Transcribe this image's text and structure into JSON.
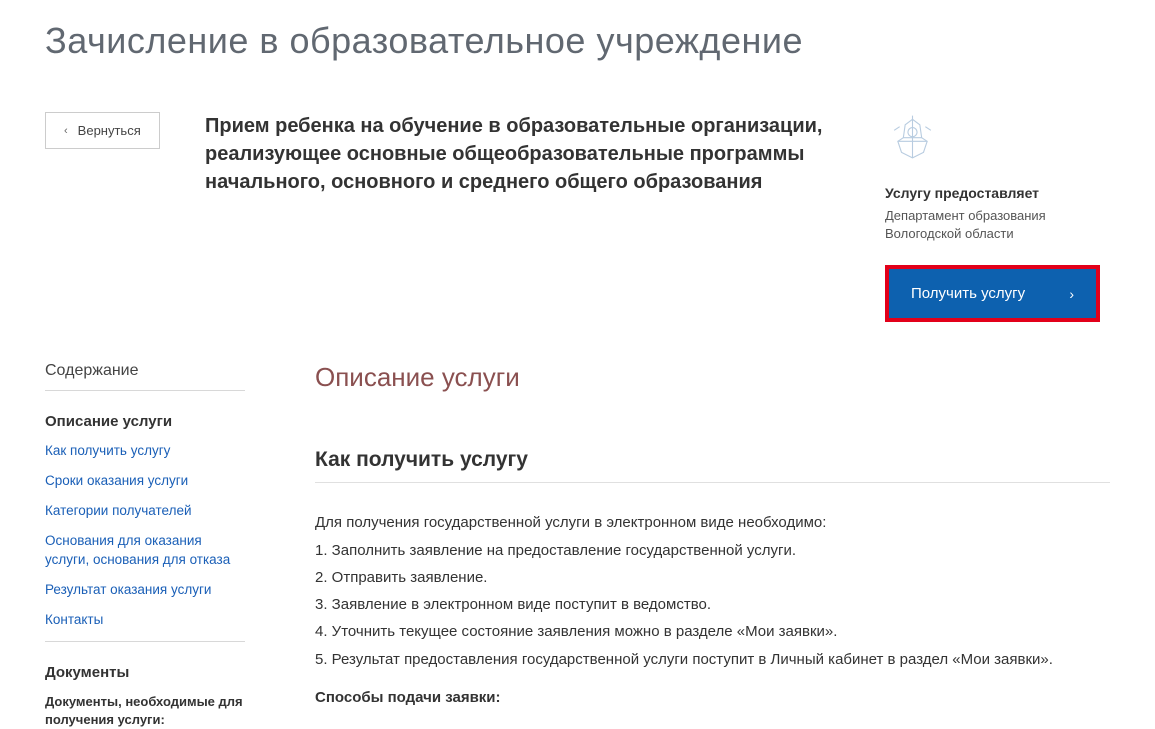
{
  "pageTitle": "Зачисление в образовательное учреждение",
  "backButton": "Вернуться",
  "subtitle": "Прием ребенка на обучение в образовательные организации, реализующее основные общеобразовательные программы начального, основного и среднего общего образования",
  "providerLabel": "Услугу предоставляет",
  "providerName": "Департамент образования Вологодской области",
  "getServiceLabel": "Получить услугу",
  "toc": {
    "title": "Содержание",
    "heading1": "Описание услуги",
    "links": [
      "Как получить услугу",
      "Сроки оказания услуги",
      "Категории получателей",
      "Основания для оказания услуги, основания для отказа",
      "Результат оказания услуги",
      "Контакты"
    ],
    "heading2": "Документы",
    "subtext": "Документы, необходимые для получения услуги:"
  },
  "main": {
    "descTitle": "Описание услуги",
    "sectionHeading": "Как получить услугу",
    "intro": "Для получения государственной услуги в электронном виде необходимо:",
    "steps": [
      "1. Заполнить заявление на предоставление государственной услуги.",
      "2. Отправить заявление.",
      "3. Заявление в электронном виде поступит в ведомство.",
      "4. Уточнить текущее состояние заявления можно в разделе «Мои заявки».",
      "5. Результат предоставления государственной услуги поступит в Личный кабинет в раздел «Мои заявки»."
    ],
    "submitHeading": "Способы подачи заявки:"
  }
}
